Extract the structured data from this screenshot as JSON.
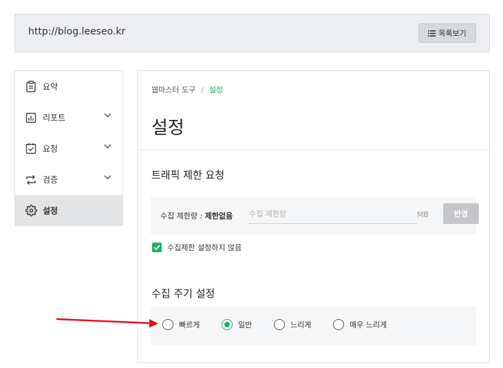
{
  "url_bar": {
    "url": "http://blog.leeseo.kr",
    "list_button_label": "목록보기"
  },
  "sidebar": {
    "items": [
      {
        "label": "요약",
        "icon": "clipboard-icon",
        "has_chevron": false,
        "active": false
      },
      {
        "label": "리포트",
        "icon": "bar-chart-icon",
        "has_chevron": true,
        "active": false
      },
      {
        "label": "요청",
        "icon": "checkbox-icon",
        "has_chevron": true,
        "active": false
      },
      {
        "label": "검증",
        "icon": "repeat-icon",
        "has_chevron": true,
        "active": false
      },
      {
        "label": "설정",
        "icon": "gear-icon",
        "has_chevron": false,
        "active": true
      }
    ]
  },
  "main": {
    "breadcrumb": {
      "parent": "웹마스터 도구",
      "separator": "/",
      "current": "설정"
    },
    "title": "설정",
    "traffic": {
      "title": "트래픽 제한 요청",
      "limit_label": "수집 제한량 : ",
      "limit_value": "제한없음",
      "input_placeholder": "수집 제한량",
      "input_value": "",
      "unit": "MB",
      "apply_label": "반영",
      "checkbox_label": "수집제한 설정하지 않음",
      "checkbox_checked": true
    },
    "crawl": {
      "title": "수집 주기 설정",
      "options": [
        {
          "label": "빠르게",
          "selected": false
        },
        {
          "label": "일반",
          "selected": true
        },
        {
          "label": "느리게",
          "selected": false
        },
        {
          "label": "매우 느리게",
          "selected": false
        }
      ]
    }
  },
  "colors": {
    "accent": "#19b26b",
    "arrow": "#e3131b",
    "panel_bg": "#f5f6f7",
    "urlbar_bg": "#eceef1"
  }
}
